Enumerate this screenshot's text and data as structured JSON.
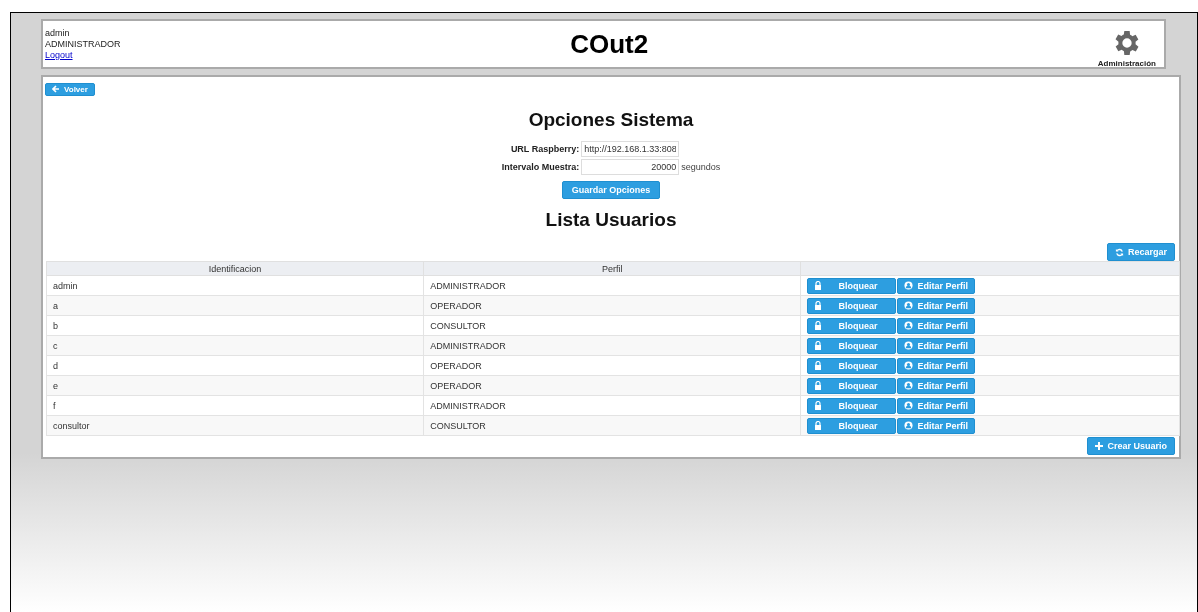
{
  "user": {
    "name": "admin",
    "profile": "ADMINISTRADOR",
    "logout": "Logout"
  },
  "app_title": "COut2",
  "admin_link": {
    "label": "Administración"
  },
  "back_button": "Volver",
  "options": {
    "title": "Opciones Sistema",
    "fields": [
      {
        "label": "URL Raspberry:",
        "value": "http://192.168.1.33:808",
        "kind": "text"
      },
      {
        "label": "Intervalo Muestra:",
        "value": "20000",
        "kind": "number",
        "suffix": "segundos"
      }
    ],
    "save_button": "Guardar Opciones"
  },
  "users": {
    "title": "Lista Usuarios",
    "reload_button": "Recargar",
    "columns": [
      "Identificacion",
      "Perfil"
    ],
    "rows": [
      {
        "id": "admin",
        "profile": "ADMINISTRADOR",
        "block": "Bloquear",
        "edit": "Editar Perfil"
      },
      {
        "id": "a",
        "profile": "OPERADOR",
        "block": "Bloquear",
        "edit": "Editar Perfil"
      },
      {
        "id": "b",
        "profile": "CONSULTOR",
        "block": "Bloquear",
        "edit": "Editar Perfil"
      },
      {
        "id": "c",
        "profile": "ADMINISTRADOR",
        "block": "Bloquear",
        "edit": "Editar Perfil"
      },
      {
        "id": "d",
        "profile": "OPERADOR",
        "block": "Bloquear",
        "edit": "Editar Perfil"
      },
      {
        "id": "e",
        "profile": "OPERADOR",
        "block": "Bloquear",
        "edit": "Editar Perfil"
      },
      {
        "id": "f",
        "profile": "ADMINISTRADOR",
        "block": "Bloquear",
        "edit": "Editar Perfil"
      },
      {
        "id": "consultor",
        "profile": "CONSULTOR",
        "block": "Bloquear",
        "edit": "Editar Perfil"
      }
    ],
    "create_button": "Crear Usuario"
  }
}
